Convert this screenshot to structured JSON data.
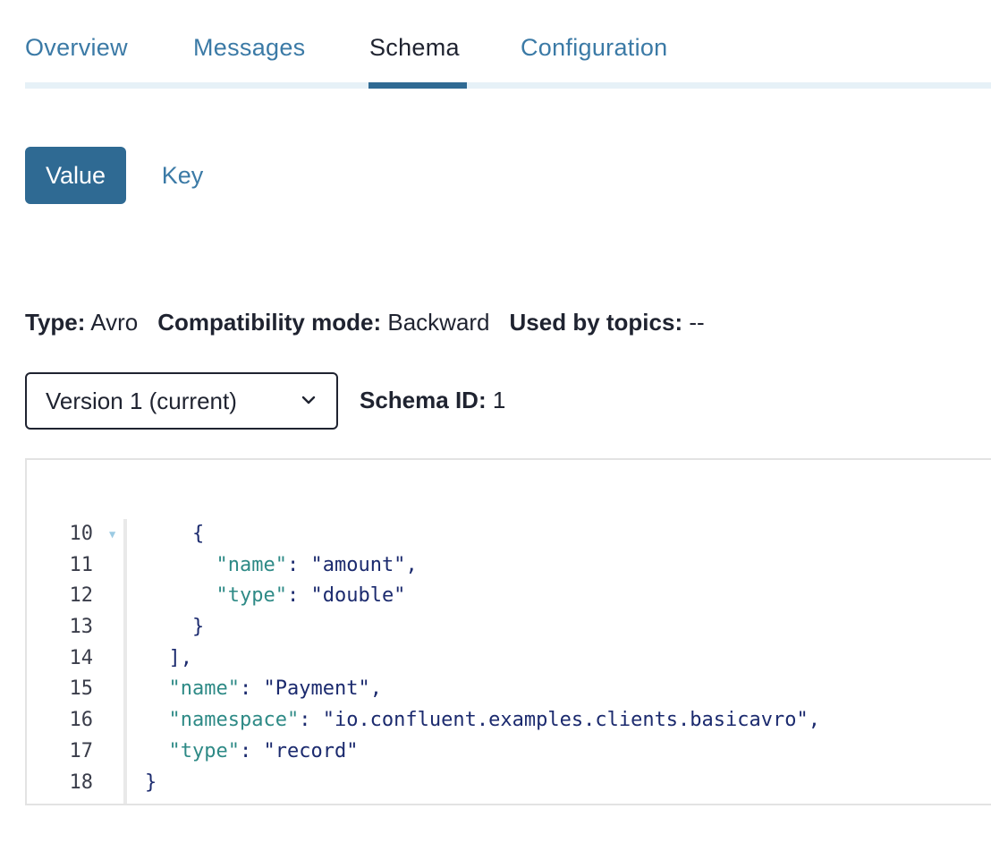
{
  "tabs": [
    {
      "label": "Overview",
      "active": false
    },
    {
      "label": "Messages",
      "active": false
    },
    {
      "label": "Schema",
      "active": true
    },
    {
      "label": "Configuration",
      "active": false
    }
  ],
  "schema_toggle": {
    "value_label": "Value",
    "key_label": "Key",
    "selected": "Value"
  },
  "meta": {
    "type_label": "Type:",
    "type_value": "Avro",
    "compat_label": "Compatibility mode:",
    "compat_value": "Backward",
    "used_label": "Used by topics:",
    "used_value": "--"
  },
  "version_select": {
    "selected": "Version 1 (current)"
  },
  "schema_id": {
    "label": "Schema ID:",
    "value": "1"
  },
  "code": {
    "fold_marker_line": "10",
    "lines": [
      {
        "n": "10",
        "indent": "    ",
        "parts": [
          {
            "t": "p",
            "v": "{"
          }
        ]
      },
      {
        "n": "11",
        "indent": "      ",
        "parts": [
          {
            "t": "k",
            "v": "\"name\""
          },
          {
            "t": "p",
            "v": ": "
          },
          {
            "t": "s",
            "v": "\"amount\""
          },
          {
            "t": "p",
            "v": ","
          }
        ]
      },
      {
        "n": "12",
        "indent": "      ",
        "parts": [
          {
            "t": "k",
            "v": "\"type\""
          },
          {
            "t": "p",
            "v": ": "
          },
          {
            "t": "s",
            "v": "\"double\""
          }
        ]
      },
      {
        "n": "13",
        "indent": "    ",
        "parts": [
          {
            "t": "p",
            "v": "}"
          }
        ]
      },
      {
        "n": "14",
        "indent": "  ",
        "parts": [
          {
            "t": "p",
            "v": "],"
          }
        ]
      },
      {
        "n": "15",
        "indent": "  ",
        "parts": [
          {
            "t": "k",
            "v": "\"name\""
          },
          {
            "t": "p",
            "v": ": "
          },
          {
            "t": "s",
            "v": "\"Payment\""
          },
          {
            "t": "p",
            "v": ","
          }
        ]
      },
      {
        "n": "16",
        "indent": "  ",
        "parts": [
          {
            "t": "k",
            "v": "\"namespace\""
          },
          {
            "t": "p",
            "v": ": "
          },
          {
            "t": "s",
            "v": "\"io.confluent.examples.clients.basicavro\""
          },
          {
            "t": "p",
            "v": ","
          }
        ]
      },
      {
        "n": "17",
        "indent": "  ",
        "parts": [
          {
            "t": "k",
            "v": "\"type\""
          },
          {
            "t": "p",
            "v": ": "
          },
          {
            "t": "s",
            "v": "\"record\""
          }
        ]
      },
      {
        "n": "18",
        "indent": "",
        "parts": [
          {
            "t": "p",
            "v": "}"
          }
        ]
      }
    ]
  },
  "colors": {
    "accent": "#2f6a93",
    "link": "#3b7aa6",
    "json_key": "#2e8a86",
    "json_string": "#1b2a6e",
    "tab_rail": "#e6f1f7"
  }
}
